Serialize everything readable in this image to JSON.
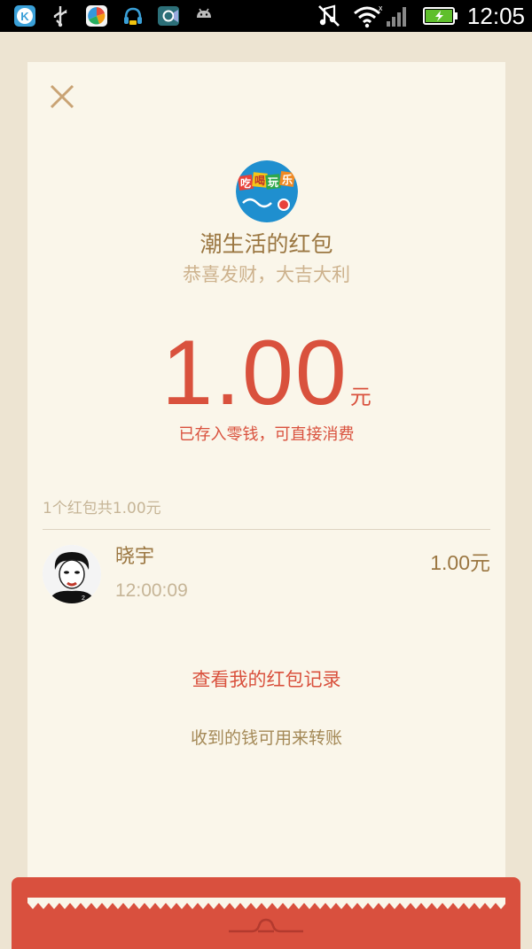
{
  "statusbar": {
    "time": "12:05",
    "notification_icons": [
      "k-app-icon",
      "usb-icon",
      "color-app-icon",
      "headset-app-icon",
      "camera-app-icon",
      "android-icon"
    ],
    "system_icons": [
      "muted-icon",
      "wifi-icon",
      "signal-icon",
      "battery-charging-icon"
    ]
  },
  "card": {
    "sender_title": "潮生活的红包",
    "blessing": "恭喜发财，大吉大利",
    "logo_text": [
      "吃",
      "喝",
      "玩",
      "乐"
    ],
    "amount": "1.00",
    "unit": "元",
    "saved_note": "已存入零钱，可直接消费",
    "summary": "1个红包共1.00元",
    "records": [
      {
        "name": "晓宇",
        "time": "12:00:09",
        "amount": "1.00元"
      }
    ],
    "history_link": "查看我的红包记录",
    "transfer_note": "收到的钱可用来转账"
  },
  "colors": {
    "accent_red": "#d9513d",
    "gold_text": "#9b7742",
    "light_gold_text": "#cdb28d",
    "card_bg": "#faf6ea",
    "page_bg": "#ede4d2"
  }
}
